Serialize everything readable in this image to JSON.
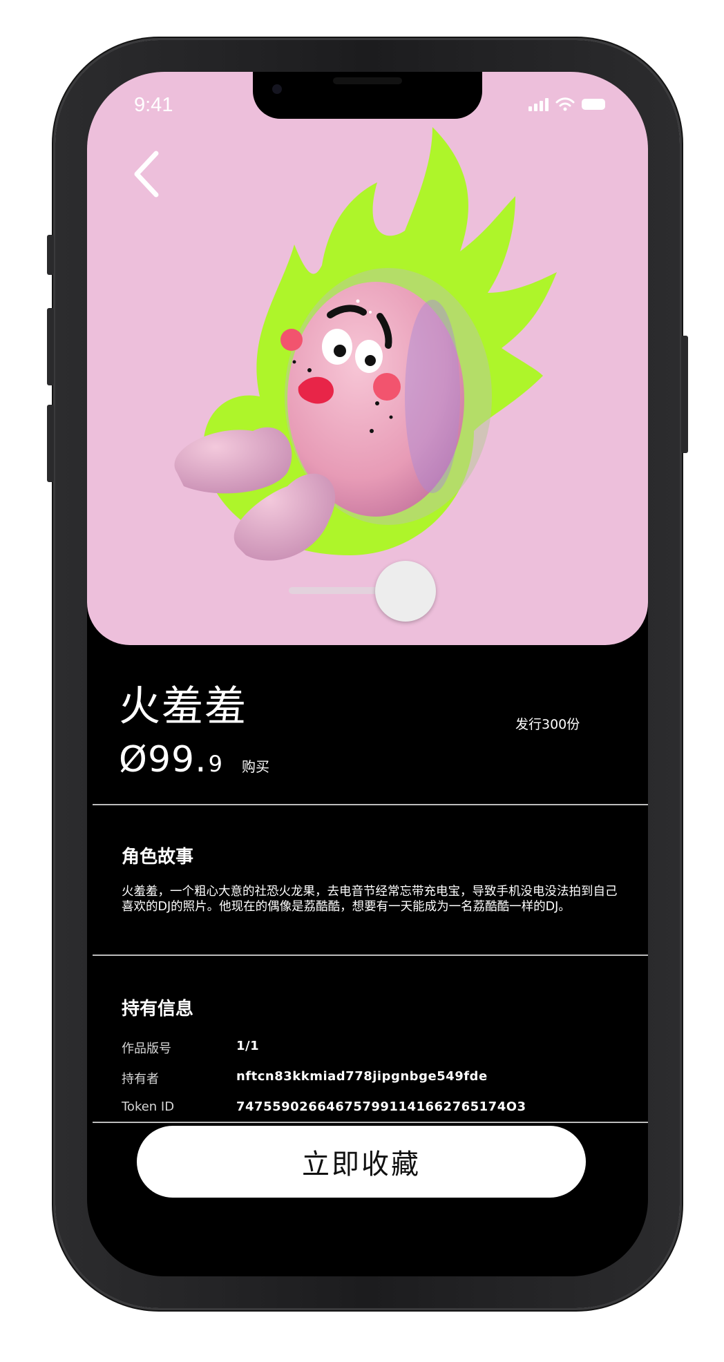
{
  "status_bar": {
    "time": "9:41"
  },
  "nft": {
    "name": "火羞羞",
    "edition_text": "发行300份",
    "price_symbol": "Ø",
    "price_main": "99.",
    "price_decimal": "9",
    "buy_label": "购买"
  },
  "story": {
    "title": "角色故事",
    "text": "火羞羞，一个粗心大意的社恐火龙果，去电音节经常忘带充电宝，导致手机没电没法拍到自己喜欢的DJ的照片。他现在的偶像是荔酷酷，想要有一天能成为一名荔酷酷一样的DJ。"
  },
  "holding": {
    "title": "持有信息",
    "rows": [
      {
        "label": "作品版号",
        "value": "1/1"
      },
      {
        "label": "持有者",
        "value": "nftcn83kkmiad778jipgnbge549fde"
      },
      {
        "label": "Token ID",
        "value": "747559026646757991141662765174O3"
      }
    ]
  },
  "action": {
    "collect_label": "立即收藏"
  },
  "colors": {
    "hero_bg": "#edbfdb",
    "flame": "#aef52a",
    "screen_bg": "#000000",
    "button_bg": "#ffffff"
  }
}
